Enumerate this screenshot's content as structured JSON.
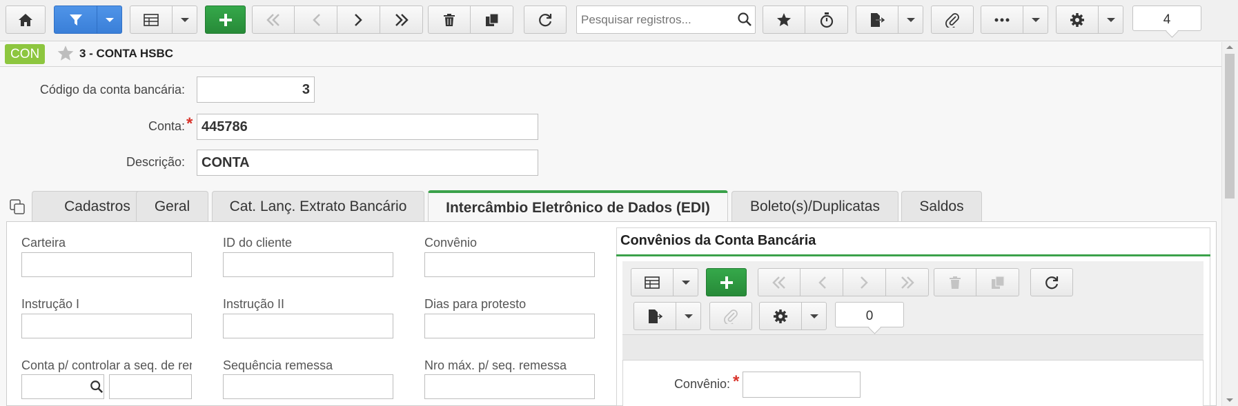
{
  "toolbar": {
    "search_placeholder": "Pesquisar registros...",
    "record_count": "4"
  },
  "header": {
    "badge": "CON",
    "title": "3 - CONTA HSBC"
  },
  "form": {
    "codigo_label": "Código da conta bancária:",
    "codigo_value": "3",
    "conta_label": "Conta:",
    "conta_value": "445786",
    "descricao_label": "Descrição:",
    "descricao_value": "CONTA"
  },
  "tabs": [
    {
      "label": "Cadastros"
    },
    {
      "label": "Geral"
    },
    {
      "label": "Cat. Lanç. Extrato Bancário"
    },
    {
      "label": "Intercâmbio Eletrônico de Dados (EDI)"
    },
    {
      "label": "Boleto(s)/Duplicatas"
    },
    {
      "label": "Saldos"
    }
  ],
  "edi": {
    "carteira": "Carteira",
    "id_cliente": "ID do cliente",
    "convenio": "Convênio",
    "instrucao1": "Instrução I",
    "instrucao2": "Instrução II",
    "dias_protesto": "Dias para protesto",
    "conta_seq": "Conta p/ controlar a seq. de remessa",
    "sequencia_remessa": "Sequência remessa",
    "nro_max": "Nro máx. p/ seq. remessa"
  },
  "convenios": {
    "title": "Convênios da Conta Bancária",
    "record_count": "0",
    "convenio_label": "Convênio:"
  },
  "colors": {
    "accent_blue": "#3a7fd8",
    "accent_green": "#278a38",
    "badge_green": "#8dc63f",
    "required_red": "#d9342b"
  }
}
